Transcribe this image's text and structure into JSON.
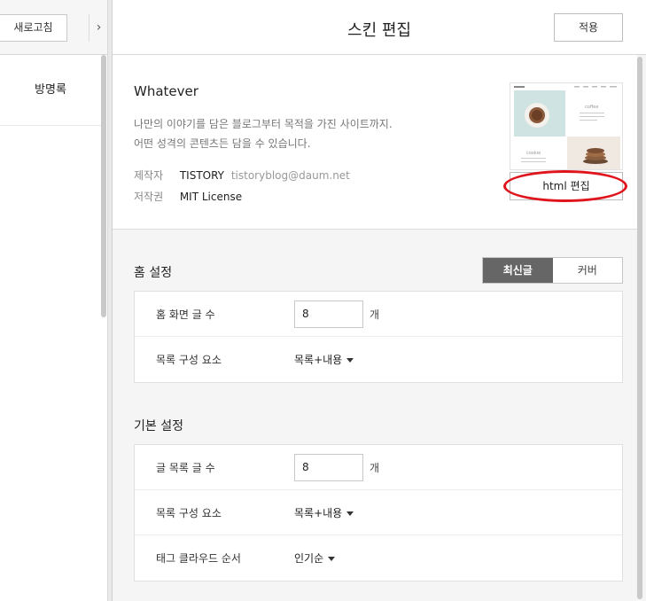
{
  "left": {
    "refresh_label": "새로고침",
    "collapse_glyph": "›",
    "nav_item": "방명록"
  },
  "header": {
    "title": "스킨 편집",
    "apply_label": "적용"
  },
  "skin": {
    "name": "Whatever",
    "desc_line1": "나만의 이야기를 담은 블로그부터 목적을 가진 사이트까지.",
    "desc_line2": "어떤 성격의 콘텐츠든 담을 수 있습니다.",
    "author_key": "제작자",
    "author_name": "TISTORY",
    "author_email": "tistoryblog@daum.net",
    "license_key": "저작권",
    "license_value": "MIT License",
    "html_edit_label": "html 편집",
    "thumb_text_coffee": "coffee",
    "thumb_text_cookie": "cookie"
  },
  "home": {
    "title": "홈 설정",
    "seg_latest": "최신글",
    "seg_cover": "커버",
    "posts_label": "홈 화면 글 수",
    "posts_value": "8",
    "posts_unit": "개",
    "list_label": "목록 구성 요소",
    "list_value": "목록+내용"
  },
  "basic": {
    "title": "기본 설정",
    "posts_label": "글 목록 글 수",
    "posts_value": "8",
    "posts_unit": "개",
    "list_label": "목록 구성 요소",
    "list_value": "목록+내용",
    "tag_label": "태그 클라우드 순서",
    "tag_value": "인기순"
  },
  "colors": {
    "accent_segment": "#666666",
    "highlight_oval": "#e0141c"
  }
}
